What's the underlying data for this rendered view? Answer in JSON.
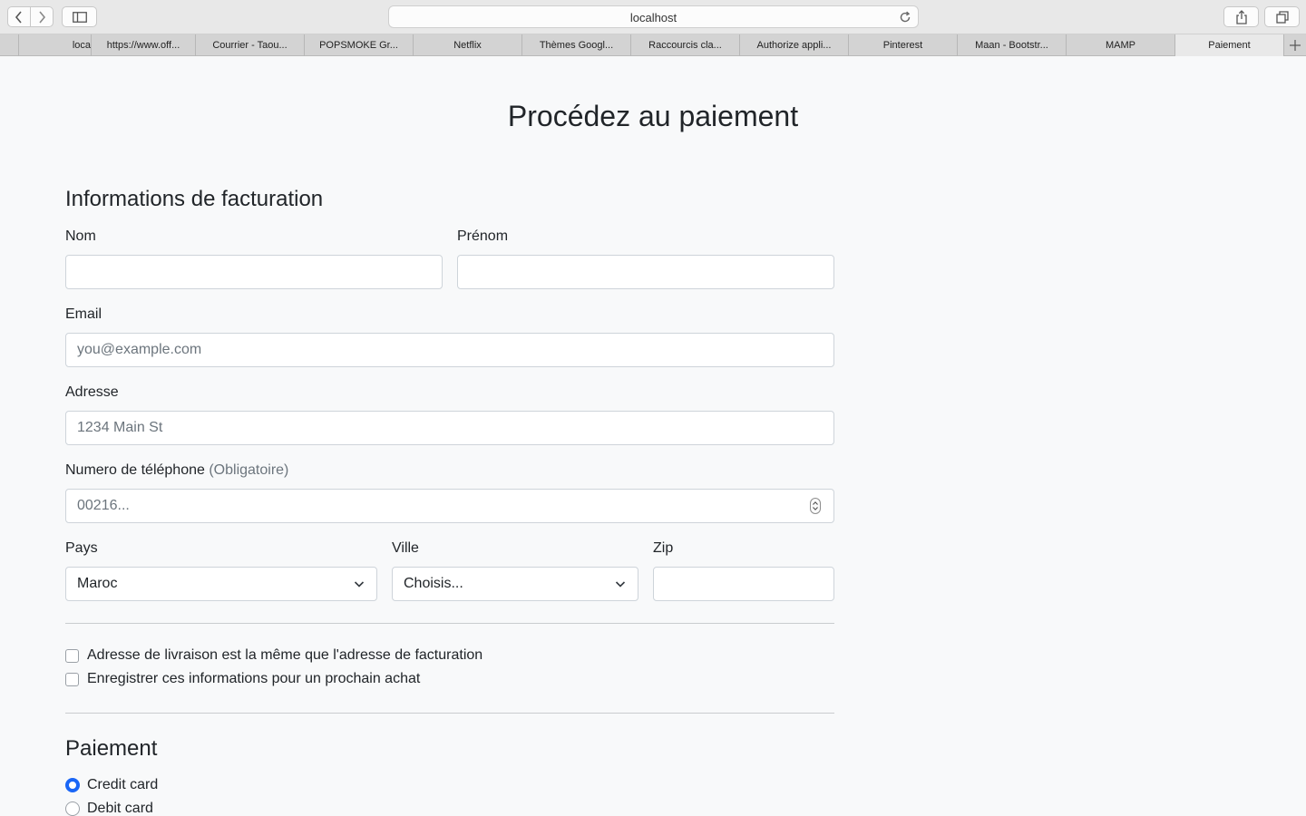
{
  "browser": {
    "url": "localhost",
    "tabs": [
      {
        "label": "loca"
      },
      {
        "label": "https://www.off..."
      },
      {
        "label": "Courrier - Taou..."
      },
      {
        "label": "POPSMOKE Gr..."
      },
      {
        "label": "Netflix"
      },
      {
        "label": "Thèmes Googl..."
      },
      {
        "label": "Raccourcis cla..."
      },
      {
        "label": "Authorize appli..."
      },
      {
        "label": "Pinterest"
      },
      {
        "label": "Maan - Bootstr..."
      },
      {
        "label": "MAMP"
      },
      {
        "label": "Paiement"
      }
    ],
    "active_tab": "Paiement"
  },
  "page": {
    "title": "Procédez au paiement"
  },
  "billing": {
    "title": "Informations de facturation",
    "nom_label": "Nom",
    "prenom_label": "Prénom",
    "email_label": "Email",
    "email_placeholder": "you@example.com",
    "adresse_label": "Adresse",
    "adresse_placeholder": "1234 Main St",
    "phone_label": "Numero de téléphone",
    "phone_hint": "(Obligatoire)",
    "phone_placeholder": "00216...",
    "pays_label": "Pays",
    "pays_value": "Maroc",
    "ville_label": "Ville",
    "ville_value": "Choisis...",
    "zip_label": "Zip"
  },
  "options": {
    "same_address": "Adresse de livraison est la même que l'adresse de facturation",
    "save_info": "Enregistrer ces informations pour un prochain achat"
  },
  "payment": {
    "title": "Paiement",
    "methods": [
      {
        "label": "Credit card",
        "selected": true
      },
      {
        "label": "Debit card",
        "selected": false
      }
    ]
  },
  "colors": {
    "accent": "#1a66f6",
    "background": "#f8f9fa"
  }
}
